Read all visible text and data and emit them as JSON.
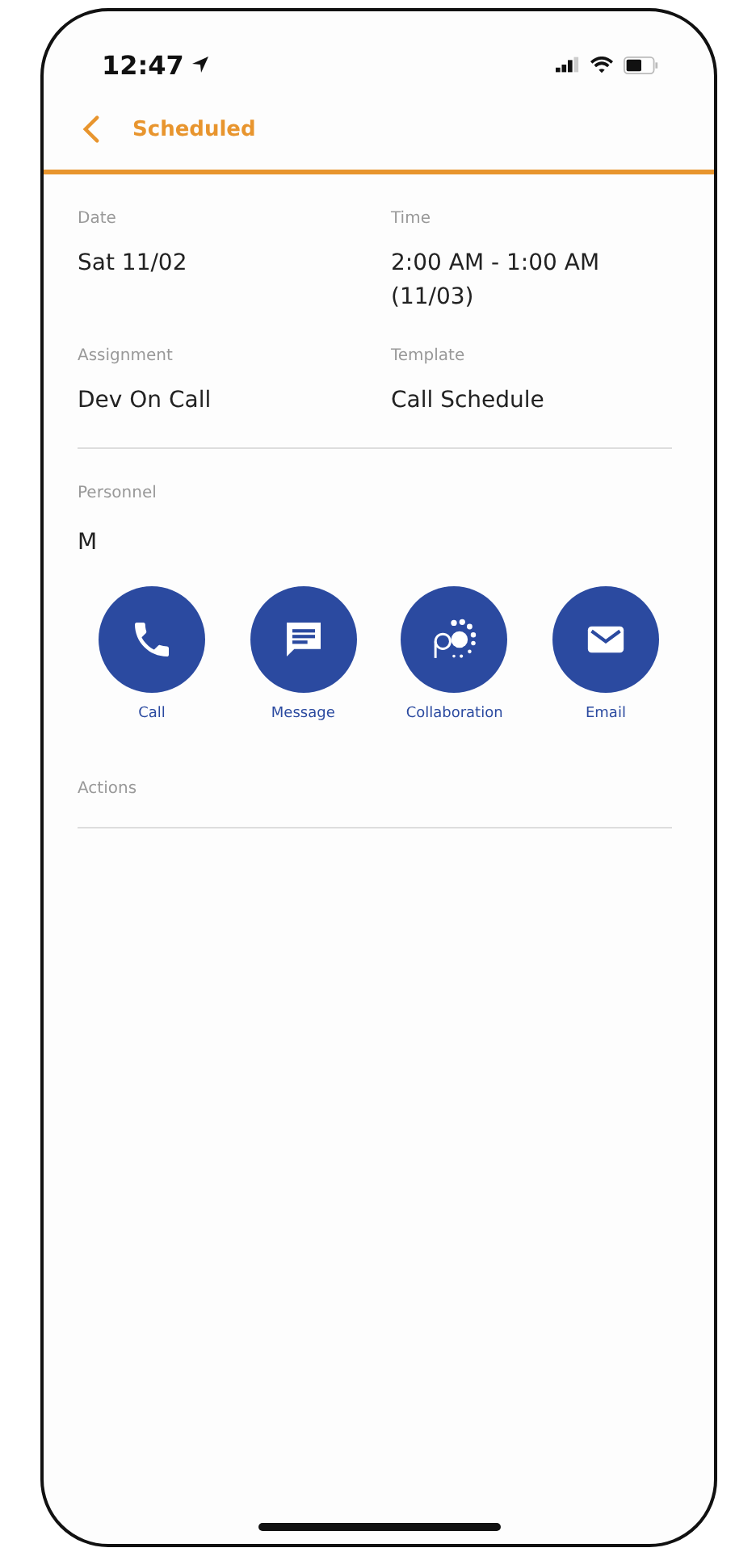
{
  "status_bar": {
    "time": "12:47"
  },
  "header": {
    "title": "Scheduled"
  },
  "fields": [
    {
      "label": "Date",
      "value": "Sat 11/02"
    },
    {
      "label": "Time",
      "value": "2:00 AM - 1:00 AM (11/03)"
    },
    {
      "label": "Assignment",
      "value": "Dev On Call"
    },
    {
      "label": "Template",
      "value": "Call Schedule"
    }
  ],
  "personnel": {
    "label": "Personnel",
    "name": "M"
  },
  "contact_actions": [
    {
      "kind": "call",
      "label": "Call"
    },
    {
      "kind": "message",
      "label": "Message"
    },
    {
      "kind": "collaboration",
      "label": "Collaboration"
    },
    {
      "kind": "email",
      "label": "Email"
    }
  ],
  "actions": {
    "label": "Actions"
  }
}
